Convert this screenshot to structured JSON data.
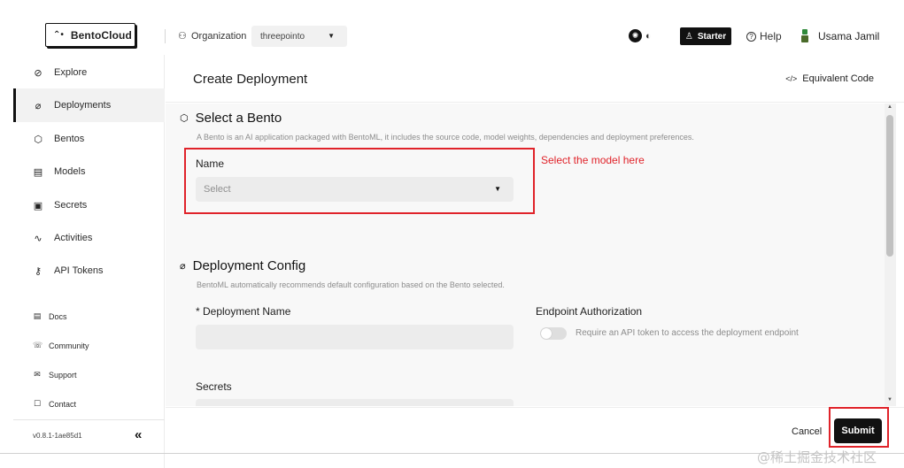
{
  "header": {
    "logo_mark": "⌃•",
    "logo_text": "BentoCloud",
    "org_icon": "⚇",
    "org_label": "Organization",
    "org_value": "threepointo",
    "theme_sun": "✺",
    "theme_moon": "◐",
    "starter_icon": "♙",
    "starter_label": "Starter",
    "help_icon": "?",
    "help_label": "Help",
    "user_name": "Usama Jamil"
  },
  "sidebar": {
    "items": [
      {
        "icon": "⊘",
        "label": "Explore"
      },
      {
        "icon": "⌀",
        "label": "Deployments"
      },
      {
        "icon": "⬡",
        "label": "Bentos"
      },
      {
        "icon": "▤",
        "label": "Models"
      },
      {
        "icon": "▣",
        "label": "Secrets"
      },
      {
        "icon": "∿",
        "label": "Activities"
      },
      {
        "icon": "⚷",
        "label": "API Tokens"
      }
    ],
    "links": [
      {
        "icon": "▤",
        "label": "Docs"
      },
      {
        "icon": "☏",
        "label": "Community"
      },
      {
        "icon": "✉",
        "label": "Support"
      },
      {
        "icon": "☐",
        "label": "Contact"
      }
    ],
    "version": "v0.8.1-1ae85d1",
    "collapse_icon": "«"
  },
  "main": {
    "title": "Create Deployment",
    "equiv_icon": "</>",
    "equiv_label": "Equivalent Code",
    "select_bento": {
      "icon": "⬡",
      "title": "Select a Bento",
      "desc": "A Bento is an AI application packaged with BentoML, it includes the source code, model weights, dependencies and deployment preferences.",
      "name_label": "Name",
      "select_placeholder": "Select",
      "annotation": "Select the model here"
    },
    "deploy_config": {
      "icon": "⌀",
      "title": "Deployment Config",
      "desc": "BentoML automatically recommends default configuration based on the Bento selected.",
      "deployment_name_label": "* Deployment Name",
      "endpoint_auth_label": "Endpoint Authorization",
      "toggle_text": "Require an API token to access the deployment endpoint",
      "secrets_label": "Secrets"
    }
  },
  "footer": {
    "cancel_label": "Cancel",
    "submit_label": "Submit"
  },
  "watermark": "@稀土掘金技术社区",
  "colors": {
    "annotation_red": "#e0232a",
    "accent_black": "#111111"
  }
}
